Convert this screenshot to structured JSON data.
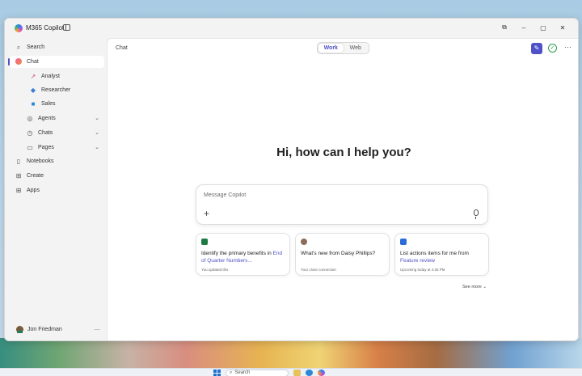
{
  "window": {
    "app_title": "M365 Copilot",
    "controls": [
      "⧉",
      "–",
      "▢",
      "✕"
    ]
  },
  "sidebar": {
    "items": [
      {
        "label": "Search",
        "icon": "search-icon",
        "glyph": "⌕"
      },
      {
        "label": "Chat",
        "icon": "chat-icon",
        "glyph": ""
      },
      {
        "label": "Analyst",
        "icon": "analyst-icon",
        "glyph": "↗"
      },
      {
        "label": "Researcher",
        "icon": "researcher-icon",
        "glyph": "◆"
      },
      {
        "label": "Sales",
        "icon": "sales-icon",
        "glyph": "■"
      },
      {
        "label": "Agents",
        "icon": "agents-icon",
        "glyph": "◎"
      },
      {
        "label": "Chats",
        "icon": "chats-icon",
        "glyph": "◷"
      },
      {
        "label": "Pages",
        "icon": "pages-icon",
        "glyph": "▭"
      },
      {
        "label": "Notebooks",
        "icon": "notebooks-icon",
        "glyph": "▯"
      },
      {
        "label": "Create",
        "icon": "create-icon",
        "glyph": "⊞"
      },
      {
        "label": "Apps",
        "icon": "apps-icon",
        "glyph": "⊞"
      }
    ],
    "active": "Chat",
    "user": {
      "name": "Jon Friedman",
      "more": "···"
    }
  },
  "main": {
    "label": "Chat",
    "toggle": {
      "work": "Work",
      "web": "Web",
      "selected": "Work"
    },
    "greeting": "Hi, how can I help you?",
    "composer": {
      "placeholder": "Message Copilot",
      "plus": "+"
    },
    "cards": [
      {
        "icon": "excel-icon",
        "color": "#1d7a45",
        "text_plain": "Identify the primary benefits in ",
        "text_link": "End of Quarter Numbers...",
        "meta": "You updated this"
      },
      {
        "icon": "person-avatar-icon",
        "color": "#8a6d5a",
        "text_plain": "What's new from Daisy Phillips?",
        "text_link": "",
        "meta": "Your close connection"
      },
      {
        "icon": "calendar-icon",
        "color": "#2b6cd8",
        "text_plain": "List actions items for me from ",
        "text_link": "Feature review",
        "meta": "Upcoming today at 4:35 PM"
      }
    ],
    "see_more": "See more ⌄"
  },
  "taskbar": {
    "search_label": "Search"
  },
  "colors": {
    "accent": "#4f52c7",
    "window_bg": "#f3f3f3",
    "main_bg": "#ffffff"
  }
}
